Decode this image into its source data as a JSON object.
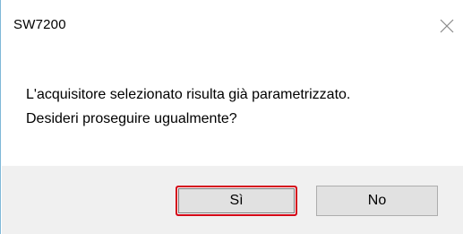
{
  "dialog": {
    "title": "SW7200",
    "close_icon": "close-x-icon",
    "message_line1": "L'acquisitore selezionato risulta già parametrizzato.",
    "message_line2": "Desideri proseguire ugualmente?",
    "buttons": {
      "yes_label": "Sì",
      "no_label": "No"
    },
    "colors": {
      "footer_bg": "#f0f0f0",
      "button_bg": "#e1e1e1",
      "highlight_border": "#d40015",
      "window_border": "#7fb8d8"
    }
  }
}
